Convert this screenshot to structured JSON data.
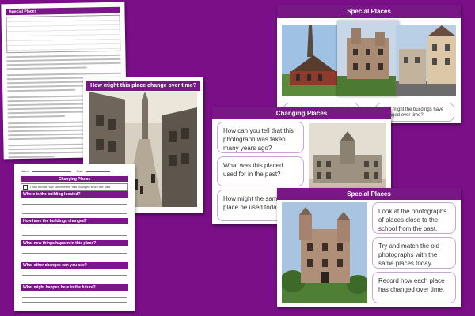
{
  "sheet1": {
    "heading": "Special Places"
  },
  "sheet2": {
    "banner": "How might this place change over time?"
  },
  "sheet3": {
    "title": "Changing Places",
    "name_label": "Name",
    "date_label": "Date",
    "checkbox_text": "I can record how somewhere has changed since the past",
    "questions": [
      "Where is the building located?",
      "How have the buildings changed?",
      "What new things happen in this place?",
      "What other changes can you see?",
      "What might happen here in the future?"
    ]
  },
  "slide_top": {
    "banner": "Special Places",
    "questions": [
      "What could the buildings be used for?",
      "How might the buildings have changed over time?"
    ]
  },
  "slide_mid": {
    "banner": "Changing Places",
    "questions": [
      "How can you tell that this photograph was taken many years ago?",
      "What was this placed used for in the past?",
      "How might the same place be used today?"
    ]
  },
  "slide_bottom": {
    "banner": "Special Places",
    "instructions": [
      "Look at the photographs of places close to the school from the past.",
      "Try and match the old photographs with the same places today.",
      "Record how each place has changed over time."
    ]
  }
}
